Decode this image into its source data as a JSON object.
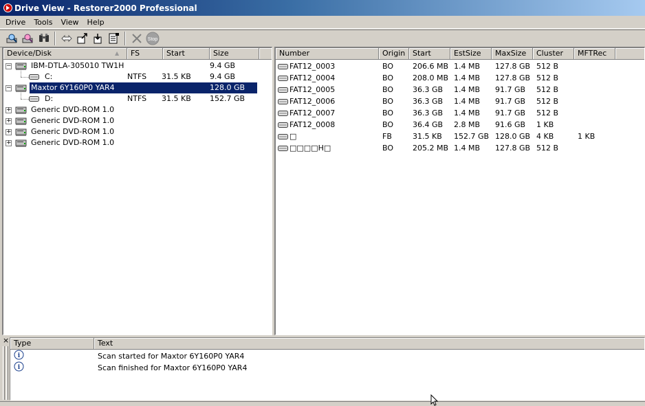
{
  "window": {
    "title": "Drive View - Restorer2000 Professional"
  },
  "menu": [
    "Drive",
    "Tools",
    "View",
    "Help"
  ],
  "toolbar": {
    "buttons": [
      "scan-icon",
      "search-icon",
      "binoculars-icon",
      "compare-icon",
      "export-icon",
      "mount-icon",
      "copy-icon",
      "delete-icon",
      "stop-icon"
    ],
    "stop_label": "Stop"
  },
  "left": {
    "columns": [
      "Device/Disk",
      "FS",
      "Start",
      "Size"
    ],
    "rows": [
      {
        "name": "IBM-DTLA-305010 TW1H",
        "fs": "",
        "start": "",
        "size": "9.4 GB",
        "level": 0,
        "expanded": true,
        "selected": false
      },
      {
        "name": "C:",
        "fs": "NTFS",
        "start": "31.5 KB",
        "size": "9.4 GB",
        "level": 1,
        "selected": false
      },
      {
        "name": "Maxtor 6Y160P0 YAR4",
        "fs": "",
        "start": "",
        "size": "128.0 GB",
        "level": 0,
        "expanded": true,
        "selected": true
      },
      {
        "name": "D:",
        "fs": "NTFS",
        "start": "31.5 KB",
        "size": "152.7 GB",
        "level": 1,
        "selected": false
      },
      {
        "name": "Generic DVD-ROM 1.0",
        "fs": "",
        "start": "",
        "size": "",
        "level": 0,
        "expanded": false,
        "selected": false
      },
      {
        "name": "Generic DVD-ROM 1.0",
        "fs": "",
        "start": "",
        "size": "",
        "level": 0,
        "expanded": false,
        "selected": false
      },
      {
        "name": "Generic DVD-ROM 1.0",
        "fs": "",
        "start": "",
        "size": "",
        "level": 0,
        "expanded": false,
        "selected": false
      },
      {
        "name": "Generic DVD-ROM 1.0",
        "fs": "",
        "start": "",
        "size": "",
        "level": 0,
        "expanded": false,
        "selected": false
      }
    ]
  },
  "right": {
    "columns": [
      "Number",
      "Origin",
      "Start",
      "EstSize",
      "MaxSize",
      "Cluster",
      "MFTRec"
    ],
    "rows": [
      [
        "FAT12_0003",
        "BO",
        "206.6 MB",
        "1.4 MB",
        "127.8 GB",
        "512 B",
        ""
      ],
      [
        "FAT12_0004",
        "BO",
        "208.0 MB",
        "1.4 MB",
        "127.8 GB",
        "512 B",
        ""
      ],
      [
        "FAT12_0005",
        "BO",
        "36.3 GB",
        "1.4 MB",
        "91.7 GB",
        "512 B",
        ""
      ],
      [
        "FAT12_0006",
        "BO",
        "36.3 GB",
        "1.4 MB",
        "91.7 GB",
        "512 B",
        ""
      ],
      [
        "FAT12_0007",
        "BO",
        "36.3 GB",
        "1.4 MB",
        "91.7 GB",
        "512 B",
        ""
      ],
      [
        "FAT12_0008",
        "BO",
        "36.4 GB",
        "2.8 MB",
        "91.6 GB",
        "1 KB",
        ""
      ],
      [
        "□",
        "FB",
        "31.5 KB",
        "152.7 GB",
        "128.0 GB",
        "4 KB",
        "1 KB"
      ],
      [
        "□□□□H□",
        "BO",
        "205.2 MB",
        "1.4 MB",
        "127.8 GB",
        "512 B",
        ""
      ]
    ]
  },
  "log": {
    "close": "×",
    "columns": [
      "Type",
      "Text"
    ],
    "rows": [
      {
        "type": "info-icon",
        "text": "Scan started for Maxtor 6Y160P0 YAR4"
      },
      {
        "type": "info-icon",
        "text": "Scan finished for Maxtor 6Y160P0 YAR4"
      }
    ]
  },
  "colors": {
    "selection": "#0a246a",
    "titlebar": "#0a246a",
    "face": "#d4d0c8"
  }
}
